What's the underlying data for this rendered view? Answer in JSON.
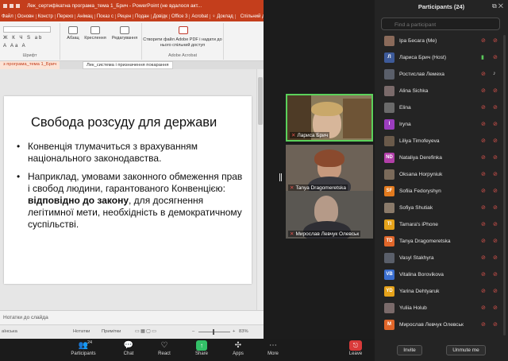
{
  "ppt": {
    "title": "Лек_сертифікатна програма_тема 1_Брич  -  PowerPoint (не вдалося акт...",
    "tabs": [
      "Файл",
      "Основн",
      "Констр",
      "Перехо",
      "Анімац",
      "Показ с",
      "Рецен",
      "Подан",
      "Довідк",
      "Office 3",
      "Acrobat",
      "♀ Доклад",
      "Спільний доступ"
    ],
    "ribbon": {
      "font_group": "Шрифт",
      "paragraph": "Абзац",
      "drawing": "Креслення",
      "editing": "Редагування",
      "adobe_text": "Створити файл Adobe PDF і надати до нього спільний доступ",
      "adobe_group": "Adobe Acrobat"
    },
    "doc_tab_1": "з програма_тема 1_Брич",
    "doc_tab_2": "Лек_система і призначення покарання",
    "slide": {
      "title": "Свобода розсуду для держави",
      "bullet1": "Конвенція тлумачиться з врахуванням національного законодавства.",
      "bullet2_pre": "Наприклад, умовами законного обмеження прав і свобод людини, гарантованого Конвенцією: ",
      "bullet2_bold": "відповідно до закону",
      "bullet2_post": ", для досягнення легітимної мети, необхідність в демократичному суспільстві."
    },
    "notes": "Нотатки до слайда",
    "status": {
      "lang": "аїнська",
      "notes": "Нотатки",
      "comments": "Примітки",
      "zoom": "83%"
    }
  },
  "gallery": {
    "tile1_name": "Лариса Брич",
    "tile2_name": "Tanya Dragomeretska",
    "tile3_name": "Мирослав Левчук Олевськ"
  },
  "panel": {
    "title": "Participants (24)",
    "search_placeholder": "Find a participant",
    "participants": [
      {
        "name": "Іра Бесага (Me)",
        "initials": "",
        "color": "#8a6a5a",
        "video": "off",
        "mic": "off"
      },
      {
        "name": "Лариса Брич (Host)",
        "initials": "Л",
        "color": "#3d5a99",
        "video": "on",
        "mic": "off"
      },
      {
        "name": "Ростислав Лемеха",
        "initials": "",
        "color": "#5a5f6a",
        "video": "off",
        "mic": "on"
      },
      {
        "name": "Alina Sichka",
        "initials": "",
        "color": "#7a6a6a",
        "video": "off",
        "mic": "off"
      },
      {
        "name": "Elina",
        "initials": "",
        "color": "#6a6a6a",
        "video": "off",
        "mic": "off"
      },
      {
        "name": "Iryna",
        "initials": "I",
        "color": "#9b3dbf",
        "video": "off",
        "mic": "off"
      },
      {
        "name": "Liliya Timofeyeva",
        "initials": "",
        "color": "#6a5a4a",
        "video": "off",
        "mic": "off"
      },
      {
        "name": "Nataliya Derefinka",
        "initials": "ND",
        "color": "#b23fa8",
        "video": "off",
        "mic": "off"
      },
      {
        "name": "Oksana Horpyniuk",
        "initials": "",
        "color": "#7a6a5a",
        "video": "off",
        "mic": "off"
      },
      {
        "name": "Sofiia Fedoryshyn",
        "initials": "SF",
        "color": "#e27a1e",
        "video": "off",
        "mic": "off"
      },
      {
        "name": "Sofiya Shutiak",
        "initials": "",
        "color": "#8a7a6a",
        "video": "off",
        "mic": "off"
      },
      {
        "name": "Tamara's iPhone",
        "initials": "TI",
        "color": "#e5a21a",
        "video": "off",
        "mic": "off"
      },
      {
        "name": "Tanya Dragomeretska",
        "initials": "TD",
        "color": "#e0662a",
        "video": "off",
        "mic": "off"
      },
      {
        "name": "Vasyl Stakhyra",
        "initials": "",
        "color": "#5a5f6a",
        "video": "off",
        "mic": "off"
      },
      {
        "name": "Vitalina Borovikova",
        "initials": "VB",
        "color": "#3b6fd0",
        "video": "off",
        "mic": "off"
      },
      {
        "name": "Yarina Dehtyaruk",
        "initials": "YD",
        "color": "#e5a21a",
        "video": "off",
        "mic": "off"
      },
      {
        "name": "Yuliia Holub",
        "initials": "",
        "color": "#7a6a6a",
        "video": "off",
        "mic": "off"
      },
      {
        "name": "Мирослав Левчук Олевськ",
        "initials": "М",
        "color": "#e0662a",
        "video": "off",
        "mic": "off"
      }
    ],
    "invite": "Invite",
    "unmute": "Unmute me"
  },
  "toolbar": {
    "participants": "Participants",
    "participants_count": "24",
    "chat": "Chat",
    "react": "React",
    "share": "Share",
    "apps": "Apps",
    "more": "More",
    "leave": "Leave"
  }
}
